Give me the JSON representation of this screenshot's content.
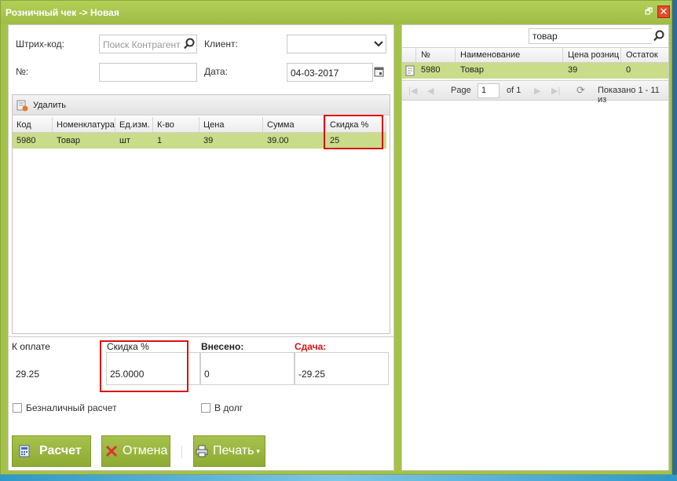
{
  "window": {
    "title": "Розничный чек -> Новая",
    "restore_glyph": "🗗",
    "close_glyph": "✕"
  },
  "form": {
    "barcode_label": "Штрих-код:",
    "barcode_placeholder": "Поиск Контрагент",
    "client_label": "Клиент:",
    "client_value": "",
    "number_label": "№:",
    "number_value": "",
    "date_label": "Дата:",
    "date_value": "04-03-2017"
  },
  "grid": {
    "delete_label": "Удалить",
    "columns": [
      "Код",
      "Номенклатура",
      "Ед.изм.",
      "К-во",
      "Цена",
      "Сумма",
      "Скидка %"
    ],
    "rows": [
      [
        "5980",
        "Товар",
        "шт",
        "1",
        "39",
        "39.00",
        "25"
      ]
    ]
  },
  "summary": {
    "to_pay_label": "К оплате",
    "to_pay_value": "29.25",
    "discount_label": "Скидка %",
    "discount_value": "25.0000",
    "paid_label": "Внесено:",
    "paid_value": "0",
    "change_label": "Сдача:",
    "change_value": "-29.25",
    "cashless_label": "Безналичный расчет",
    "credit_label": "В долг"
  },
  "buttons": {
    "calc": "Расчет",
    "cancel": "Отмена",
    "print": "Печать"
  },
  "catalog": {
    "search_value": "товар",
    "columns": [
      "№",
      "Наименование",
      "Цена розниц",
      "Остаток"
    ],
    "rows": [
      [
        "5980",
        "Товар",
        "39",
        "0"
      ]
    ],
    "page_label": "Page",
    "page_value": "1",
    "of_label": "of 1",
    "shown_label": "Показано 1 - 11 из"
  },
  "colors": {
    "accent": "#9fbd45",
    "selected_row": "#c9dc8a",
    "highlight": "#d11111",
    "change_label": "#d11111"
  }
}
